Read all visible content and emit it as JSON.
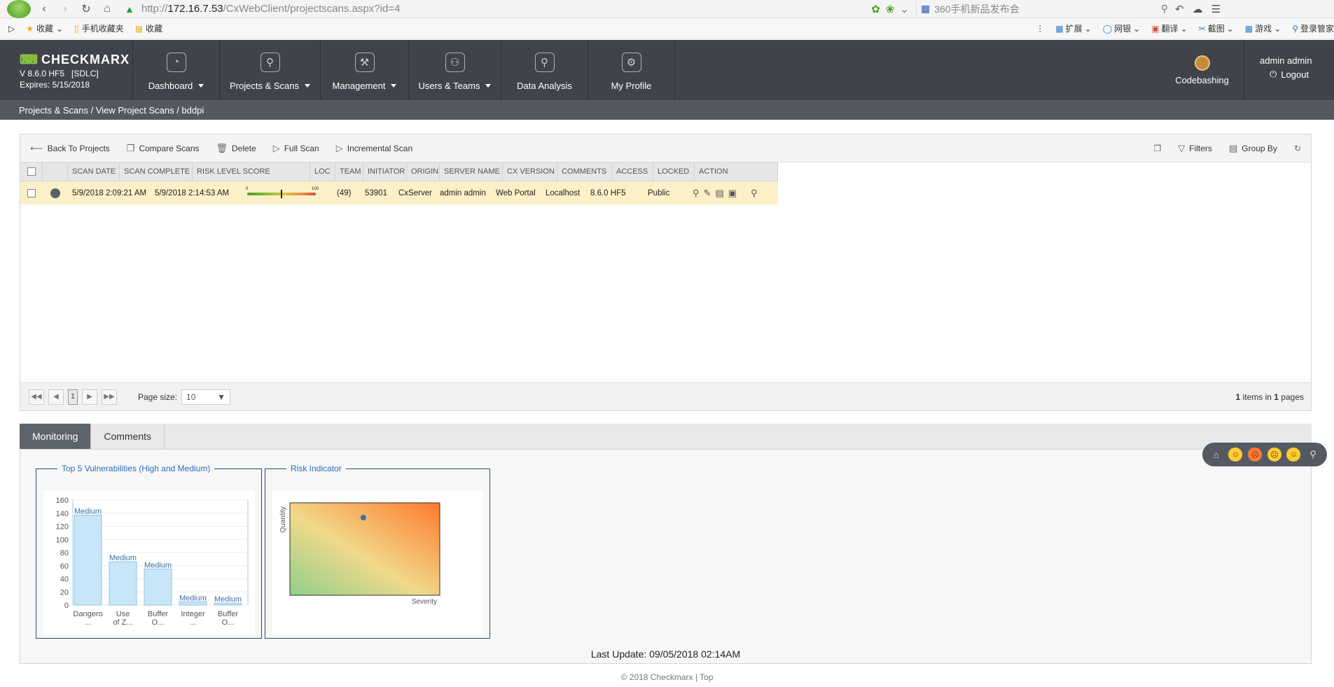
{
  "browser": {
    "url_prefix": "http://",
    "url_host": "172.16.7.53",
    "url_path": "/CxWebClient/projectscans.aspx?id=4",
    "search_text": "360手机新品发布会"
  },
  "favorites": {
    "items": [
      "收藏",
      "手机收藏夹",
      "收藏"
    ],
    "right": [
      "扩展",
      "网银",
      "翻译",
      "截图",
      "游戏",
      "登录管家"
    ]
  },
  "header": {
    "brand": "CHECKMARX",
    "version": "V 8.6.0 HF5   [SDLC]",
    "expires": "Expires: 5/15/2018",
    "nav": [
      {
        "label": "Dashboard",
        "icon": "gauge-icon"
      },
      {
        "label": "Projects & Scans",
        "icon": "projects-icon"
      },
      {
        "label": "Management",
        "icon": "wrench-icon"
      },
      {
        "label": "Users & Teams",
        "icon": "users-icon"
      },
      {
        "label": "Data Analysis",
        "icon": "analysis-icon"
      },
      {
        "label": "My Profile",
        "icon": "profile-icon"
      }
    ],
    "codebashing": "Codebashing",
    "user": "admin admin",
    "logout": "Logout"
  },
  "breadcrumb": "Projects & Scans / View Project Scans / bddpi",
  "toolbar": {
    "back": "Back To Projects",
    "compare": "Compare Scans",
    "delete": "Delete",
    "full": "Full Scan",
    "incremental": "Incremental Scan",
    "filters": "Filters",
    "group_by": "Group By"
  },
  "grid": {
    "columns": [
      "SCAN DATE",
      "SCAN COMPLETE",
      "RISK LEVEL SCORE",
      "LOC",
      "TEAM",
      "INITIATOR",
      "ORIGIN",
      "SERVER NAME",
      "CX VERSION",
      "COMMENTS",
      "ACCESS",
      "LOCKED",
      "ACTION"
    ],
    "rows": [
      {
        "scan_date": "5/9/2018 2:09:21 AM",
        "scan_complete": "5/9/2018 2:14:53 AM",
        "risk_min": "0",
        "risk_max": "100",
        "risk_score": "(49)",
        "loc": "53901",
        "team": "CxServer",
        "initiator": "admin admin",
        "origin": "Web Portal",
        "server": "Localhost",
        "cx_version": "8.6.0 HF5",
        "access": "Public"
      }
    ]
  },
  "risk_level": 49,
  "pager": {
    "current_page": "1",
    "page_size_label": "Page size:",
    "page_size": "10",
    "items_count": "1",
    "pages_count": "1",
    "items_text": "items in",
    "pages_text": "pages"
  },
  "tabs": [
    "Monitoring",
    "Comments"
  ],
  "monitor": {
    "top5_title": "Top 5 Vulnerabilities (High and Medium)",
    "risk_title": "Risk Indicator",
    "last_update": "Last Update: 09/05/2018 02:14AM"
  },
  "chart_data": [
    {
      "type": "bar",
      "title": "Top 5 Vulnerabilities (High and Medium)",
      "categories": [
        "Dangero ...",
        "Use of Z...",
        "Buffer O...",
        "Integer ...",
        "Buffer O..."
      ],
      "values": [
        137,
        66,
        55,
        5,
        3
      ],
      "data_labels": [
        "Medium",
        "Medium",
        "Medium",
        "Medium",
        "Medium"
      ],
      "ylim": [
        0,
        160
      ],
      "yticks": [
        0,
        20,
        40,
        60,
        80,
        100,
        120,
        140,
        160
      ]
    },
    {
      "type": "scatter",
      "title": "Risk Indicator",
      "xlabel": "Severity",
      "ylabel": "Quantity",
      "points": [
        {
          "x": 0.49,
          "y": 0.84
        }
      ]
    }
  ],
  "footer": "© 2018 Checkmarx | Top"
}
